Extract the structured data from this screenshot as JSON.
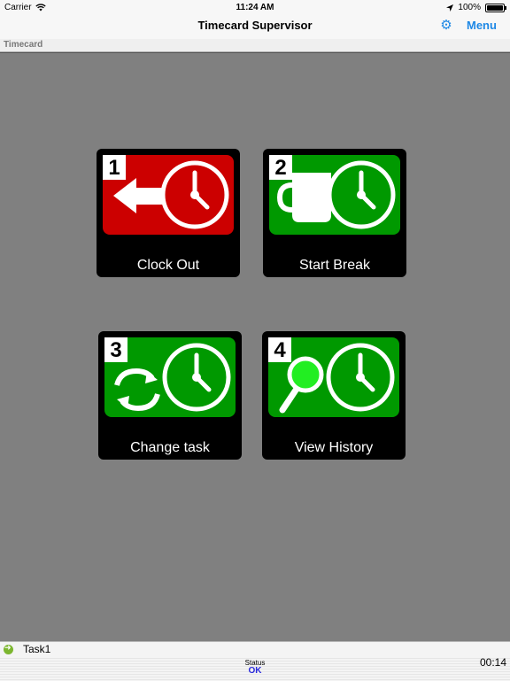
{
  "status_bar": {
    "carrier": "Carrier",
    "time": "11:24 AM",
    "battery": "100%"
  },
  "navbar": {
    "title": "Timecard Supervisor",
    "menu_label": "Menu",
    "settings_icon": "gear-icon"
  },
  "subbar": {
    "label": "Timecard"
  },
  "tiles": [
    {
      "number": "1",
      "label": "Clock Out",
      "color": "#cc0000",
      "icon": "arrow-left-clock-icon"
    },
    {
      "number": "2",
      "label": "Start Break",
      "color": "#009900",
      "icon": "cup-clock-icon"
    },
    {
      "number": "3",
      "label": "Change task",
      "color": "#009900",
      "icon": "cycle-clock-icon"
    },
    {
      "number": "4",
      "label": "View History",
      "color": "#009900",
      "icon": "magnifier-clock-icon"
    }
  ],
  "bottom": {
    "task": "Task1",
    "status_title": "Status",
    "status_value": "OK",
    "elapsed": "00:14"
  },
  "colors": {
    "background": "#808080",
    "accent": "#1e88e5"
  }
}
